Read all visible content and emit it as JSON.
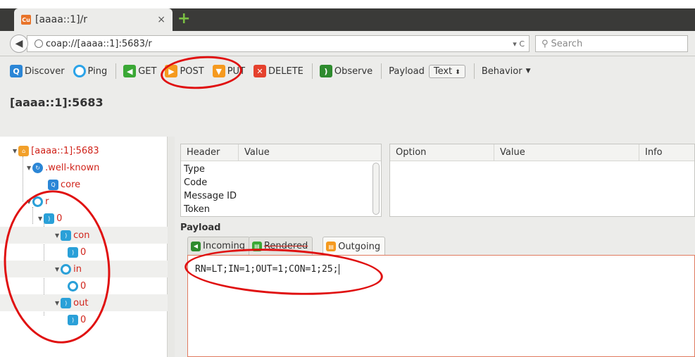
{
  "browser": {
    "tab_title": "[aaaa::1]/r",
    "tab_close": "×",
    "new_tab": "+",
    "url": "coap://[aaaa::1]:5683/r",
    "url_controls": "▾ C",
    "search_placeholder": "Search"
  },
  "toolbar": {
    "discover": "Discover",
    "ping": "Ping",
    "get": "GET",
    "post": "POST",
    "put": "PUT",
    "delete": "DELETE",
    "observe": "Observe",
    "payload_label": "Payload",
    "payload_format": "Text",
    "behavior": "Behavior"
  },
  "address_title": "[aaaa::1]:5683",
  "tree": {
    "root": "[aaaa::1]:5683",
    "well_known": ".well-known",
    "core": "core",
    "r": "r",
    "zero": "0",
    "con": "con",
    "con_child": "0",
    "in": "in",
    "in_child": "0",
    "out": "out",
    "out_child": "0"
  },
  "header_table": {
    "columns": [
      "Header",
      "Value"
    ],
    "rows": [
      "Type",
      "Code",
      "Message ID",
      "Token"
    ]
  },
  "option_table": {
    "columns": [
      "Option",
      "Value",
      "Info"
    ]
  },
  "payload": {
    "label": "Payload",
    "tabs": [
      "Incoming",
      "Rendered",
      "Outgoing"
    ],
    "text": "RN=LT;IN=1;OUT=1;CON=1;25;"
  },
  "colors": {
    "annotation": "#e01010",
    "tree_text": "#d0231a"
  }
}
